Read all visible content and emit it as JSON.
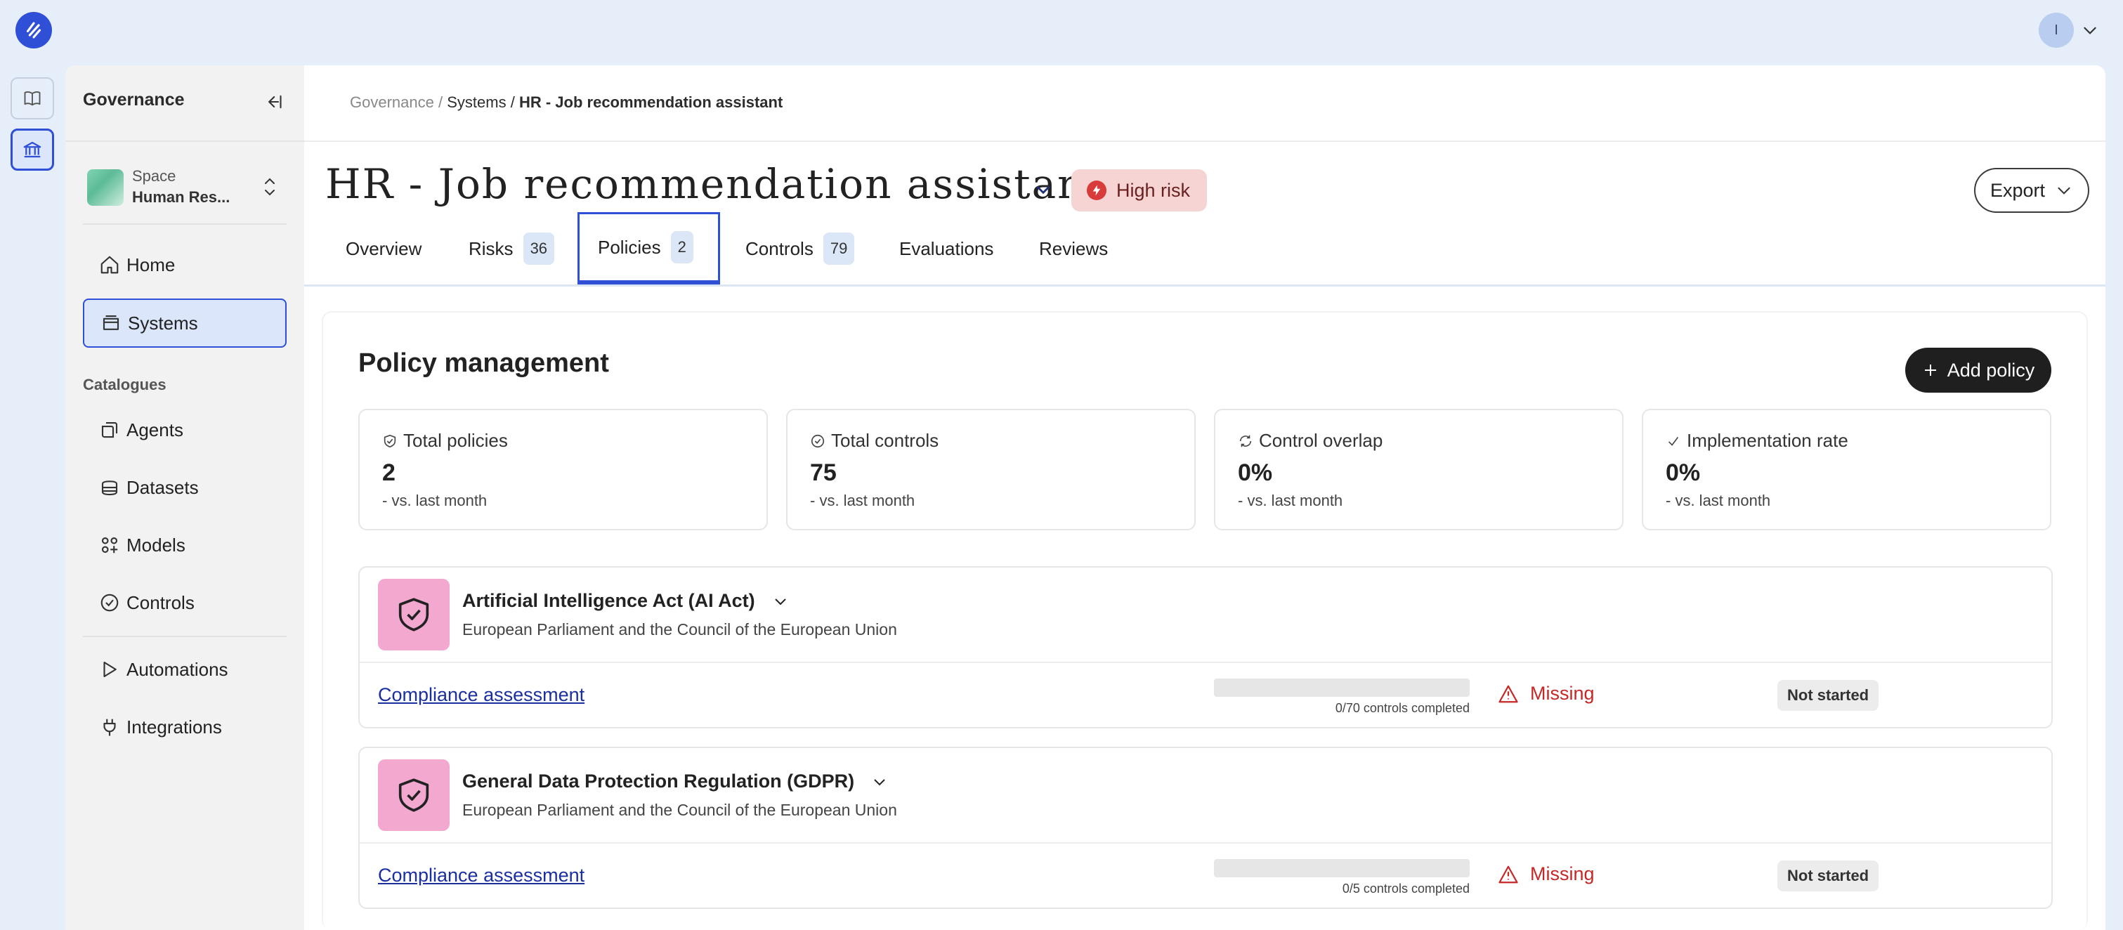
{
  "topbar": {
    "avatar_initial": "I"
  },
  "sidebar": {
    "title": "Governance",
    "space": {
      "label": "Space",
      "name": "Human Res..."
    },
    "nav": [
      {
        "label": "Home",
        "icon": "home-icon"
      },
      {
        "label": "Systems",
        "icon": "systems-icon",
        "active": true
      }
    ],
    "catalogues_label": "Catalogues",
    "catalogues": [
      {
        "label": "Agents",
        "icon": "agents-icon"
      },
      {
        "label": "Datasets",
        "icon": "datasets-icon"
      },
      {
        "label": "Models",
        "icon": "models-icon"
      },
      {
        "label": "Controls",
        "icon": "controls-icon"
      }
    ],
    "extra": [
      {
        "label": "Automations",
        "icon": "play-icon"
      },
      {
        "label": "Integrations",
        "icon": "plug-icon"
      }
    ]
  },
  "breadcrumb": {
    "root": "Governance",
    "sep": "/",
    "mid": "Systems",
    "current": "HR - Job recommendation assistant"
  },
  "header": {
    "title": "HR - Job recommendation assistant",
    "risk_badge": "High risk",
    "export_label": "Export"
  },
  "tabs": [
    {
      "label": "Overview"
    },
    {
      "label": "Risks",
      "count": "36"
    },
    {
      "label": "Policies",
      "count": "2",
      "active": true
    },
    {
      "label": "Controls",
      "count": "79"
    },
    {
      "label": "Evaluations"
    },
    {
      "label": "Reviews"
    }
  ],
  "policy_management": {
    "title": "Policy management",
    "add_label": "Add policy",
    "stats": [
      {
        "label": "Total policies",
        "value": "2",
        "delta": "-",
        "compare": "vs. last month",
        "icon": "shield-check-icon"
      },
      {
        "label": "Total controls",
        "value": "75",
        "delta": "-",
        "compare": "vs. last month",
        "icon": "check-circle-icon"
      },
      {
        "label": "Control overlap",
        "value": "0%",
        "delta": "-",
        "compare": "vs. last month",
        "icon": "refresh-icon"
      },
      {
        "label": "Implementation rate",
        "value": "0%",
        "delta": "-",
        "compare": "vs. last month",
        "icon": "checkmark-icon"
      }
    ],
    "policies": [
      {
        "name": "Artificial Intelligence Act (AI Act)",
        "org": "European Parliament and the Council of the European Union",
        "link": "Compliance assessment",
        "progress_label": "0/70 controls completed",
        "progress": 0,
        "status": "Missing",
        "state": "Not started"
      },
      {
        "name": "General Data Protection Regulation (GDPR)",
        "org": "European Parliament and the Council of the European Union",
        "link": "Compliance assessment",
        "progress_label": "0/5 controls completed",
        "progress": 0,
        "status": "Missing",
        "state": "Not started"
      }
    ]
  }
}
